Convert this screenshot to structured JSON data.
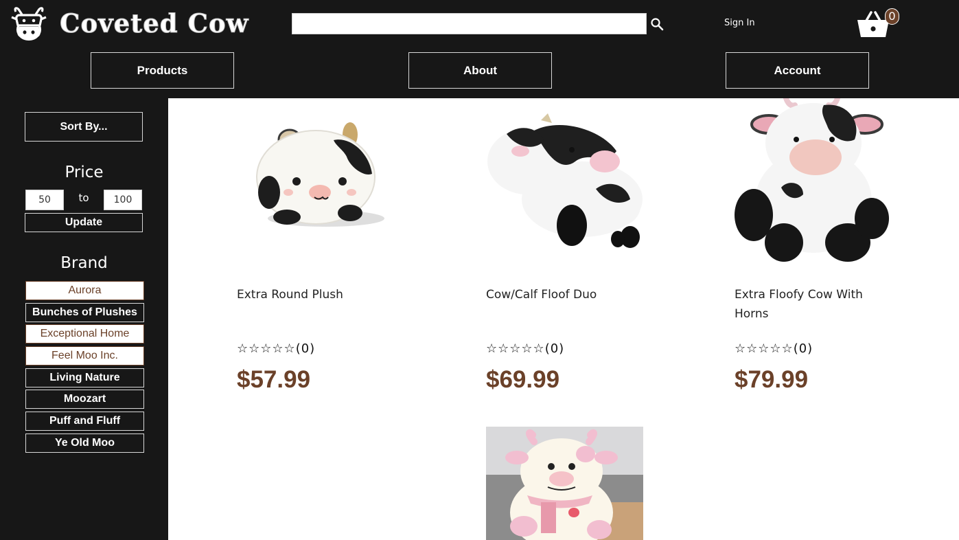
{
  "header": {
    "brand_name": "Coveted Cow",
    "search": {
      "value": "",
      "placeholder": ""
    },
    "sign_in_label": "Sign In",
    "cart_count": "0"
  },
  "nav": {
    "products_label": "Products",
    "about_label": "About",
    "account_label": "Account"
  },
  "sidebar": {
    "sort_label": "Sort By...",
    "price_heading": "Price",
    "price_min": "50",
    "price_to": "to",
    "price_max": "100",
    "update_label": "Update",
    "brand_heading": "Brand",
    "brands": [
      {
        "label": "Aurora",
        "selected": true
      },
      {
        "label": "Bunches of Plushes",
        "selected": false
      },
      {
        "label": "Exceptional Home",
        "selected": true
      },
      {
        "label": "Feel Moo Inc.",
        "selected": true
      },
      {
        "label": "Living Nature",
        "selected": false
      },
      {
        "label": "Moozart",
        "selected": false
      },
      {
        "label": "Puff and Fluff",
        "selected": false
      },
      {
        "label": "Ye Old Moo",
        "selected": false
      }
    ]
  },
  "products": [
    {
      "name": "Extra Round Plush",
      "rating_count": "(0)",
      "rating_stars": "☆☆☆☆☆",
      "price": "$57.99"
    },
    {
      "name": "Cow/Calf Floof Duo",
      "rating_count": "(0)",
      "rating_stars": "☆☆☆☆☆",
      "price": "$69.99"
    },
    {
      "name": "Extra Floofy Cow With Horns",
      "rating_count": "(0)",
      "rating_stars": "☆☆☆☆☆",
      "price": "$79.99"
    }
  ],
  "colors": {
    "header_bg": "#171717",
    "accent_brown": "#6b4129",
    "border_light": "#d9d9d9"
  },
  "icons": [
    "cow-logo-icon",
    "search-icon",
    "basket-cart-icon",
    "star-outline-icon"
  ]
}
